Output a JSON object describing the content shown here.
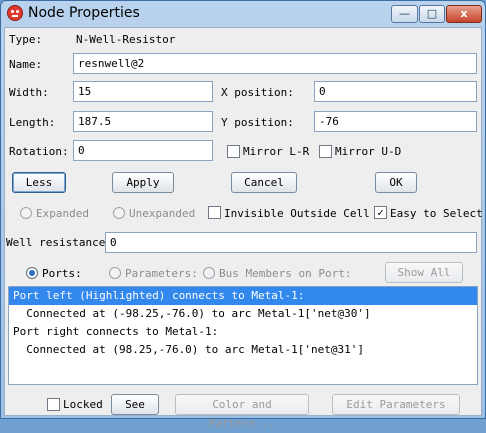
{
  "window": {
    "title": "Node Properties",
    "min_label": "—",
    "max_label": "□",
    "close_label": "x",
    "accent": "#3388ee"
  },
  "type": {
    "label": "Type:",
    "value": "N-Well-Resistor"
  },
  "name": {
    "label": "Name:",
    "value": "resnwell@2"
  },
  "width": {
    "label": "Width:",
    "value": "15"
  },
  "xpos": {
    "label": "X position:",
    "value": "0"
  },
  "length": {
    "label": "Length:",
    "value": "187.5"
  },
  "ypos": {
    "label": "Y position:",
    "value": "-76"
  },
  "rotation": {
    "label": "Rotation:",
    "value": "0"
  },
  "mirror_lr": {
    "label": "Mirror L-R",
    "checked": false
  },
  "mirror_ud": {
    "label": "Mirror U-D",
    "checked": false
  },
  "buttons": {
    "less": "Less",
    "apply": "Apply",
    "cancel": "Cancel",
    "ok": "OK"
  },
  "expanded": {
    "label": "Expanded",
    "enabled": false
  },
  "unexpanded": {
    "label": "Unexpanded",
    "enabled": false
  },
  "invisible_outside_cell": {
    "label": "Invisible Outside Cell",
    "checked": false
  },
  "easy_to_select": {
    "label": "Easy to Select",
    "checked": true
  },
  "well_resistance": {
    "label": "Well resistance:",
    "value": "0"
  },
  "list_mode": {
    "ports": {
      "label": "Ports:",
      "selected": true
    },
    "parameters": {
      "label": "Parameters:",
      "selected": false
    },
    "bus_members": {
      "label": "Bus Members on Port:",
      "selected": false
    },
    "show_all": "Show All"
  },
  "list_rows": [
    {
      "text": "Port left (Highlighted) connects to Metal-1:",
      "selected": true
    },
    {
      "text": "  Connected at (-98.25,-76.0) to arc Metal-1['net@30']",
      "selected": false
    },
    {
      "text": "Port right connects to Metal-1:",
      "selected": false
    },
    {
      "text": "  Connected at (98.25,-76.0) to arc Metal-1['net@31']",
      "selected": false
    }
  ],
  "footer": {
    "locked_label": "Locked",
    "locked": false,
    "see": "See",
    "color_pattern": "Color and Pattern...",
    "edit_parameters": "Edit Parameters"
  }
}
